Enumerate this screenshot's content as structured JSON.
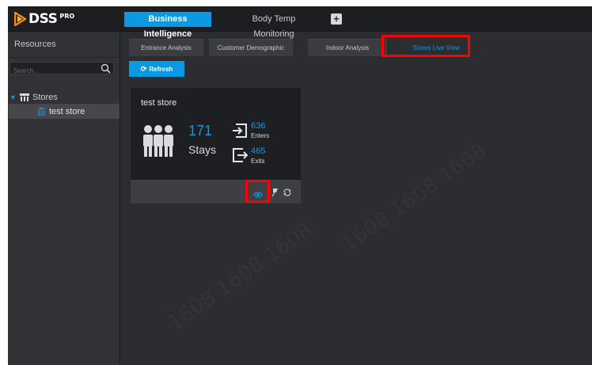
{
  "app": {
    "logo_name": "DSS",
    "logo_suffix": "PRO"
  },
  "top_tabs": {
    "active": "Business Intelligence",
    "other": "Body Temp Monitoring",
    "add": "+"
  },
  "sidebar": {
    "title": "Resources",
    "search_placeholder": "Search...",
    "tree_root": "Stores",
    "tree_child": "test store"
  },
  "sub_tabs": {
    "entrance": "Entrance Analysis",
    "customer": "Customer Demographic",
    "indoor": "Indoor Analysis",
    "live": "Stores Live View"
  },
  "toolbar": {
    "refresh": "Refresh"
  },
  "card": {
    "title": "test store",
    "stays_value": "171",
    "stays_label": "Stays",
    "enters_value": "636",
    "enters_label": "Enters",
    "exits_value": "465",
    "exits_label": "Exits"
  },
  "colors": {
    "accent": "#0a99e3",
    "highlight": "#ff0000"
  }
}
